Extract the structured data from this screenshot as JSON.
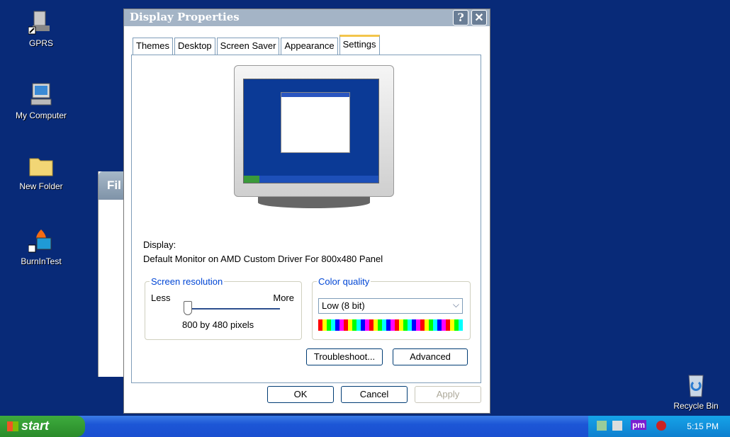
{
  "desktop": {
    "icons": [
      {
        "label": "GPRS",
        "icon": "network-icon"
      },
      {
        "label": "My Computer",
        "icon": "computer-icon"
      },
      {
        "label": "New Folder",
        "icon": "folder-icon"
      },
      {
        "label": "BurnInTest",
        "icon": "burnintest-icon"
      },
      {
        "label": "Recycle Bin",
        "icon": "recycle-bin-icon"
      }
    ]
  },
  "back_window": {
    "title_fragment": "Fil"
  },
  "dialog": {
    "title": "Display Properties",
    "help_glyph": "?",
    "close_glyph": "✕",
    "tabs": [
      "Themes",
      "Desktop",
      "Screen Saver",
      "Appearance",
      "Settings"
    ],
    "active_tab": "Settings",
    "display_label": "Display:",
    "display_value": "Default Monitor on AMD Custom Driver For 800x480 Panel",
    "screen_resolution": {
      "legend": "Screen resolution",
      "less": "Less",
      "more": "More",
      "value_text": "800 by 480 pixels",
      "slider_position": 0
    },
    "color_quality": {
      "legend": "Color quality",
      "selected": "Low (8 bit)"
    },
    "buttons": {
      "troubleshoot": "Troubleshoot...",
      "advanced": "Advanced",
      "ok": "OK",
      "cancel": "Cancel",
      "apply": "Apply"
    }
  },
  "taskbar": {
    "start_label": "start",
    "tray_text": "pm",
    "clock": "5:15 PM"
  }
}
